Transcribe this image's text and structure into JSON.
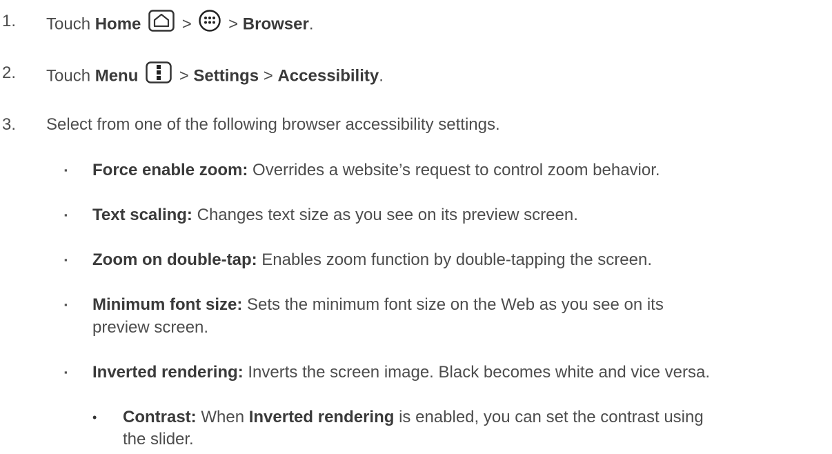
{
  "steps": [
    {
      "number": "1.",
      "prefix": "Touch ",
      "home": "Home",
      "sep1": " > ",
      "sep2": " > ",
      "browser": "Browser",
      "end": ".",
      "icons": [
        "home-icon",
        "apps-icon"
      ]
    },
    {
      "number": "2.",
      "prefix": "Touch ",
      "menu": "Menu",
      "sep1": " > ",
      "settings": "Settings",
      "sep2": " > ",
      "accessibility": "Accessibility",
      "end": ".",
      "icons": [
        "menu-icon"
      ]
    },
    {
      "number": "3.",
      "text": "Select from one of the following browser accessibility settings."
    }
  ],
  "options": [
    {
      "bullet": "▪",
      "term": "Force enable zoom:",
      "desc": " Overrides a website’s request to control zoom behavior."
    },
    {
      "bullet": "▪",
      "term": "Text scaling:",
      "desc": " Changes text size as you see on its preview screen."
    },
    {
      "bullet": "▪",
      "term": "Zoom on double-tap:",
      "desc": " Enables zoom function by double-tapping the screen."
    },
    {
      "bullet": "▪",
      "term": "Minimum font size:",
      "desc": " Sets the minimum font size on the Web as you see on its",
      "desc2": "preview screen."
    },
    {
      "bullet": "▪",
      "term": "Inverted rendering:",
      "desc": " Inverts the screen image. Black becomes white and vice versa."
    }
  ],
  "sub_option": {
    "bullet": "•",
    "term": "Contrast:",
    "desc_a": " When ",
    "term2": "Inverted rendering",
    "desc_b": " is enabled, you can set the contrast using",
    "desc2": "the slider."
  }
}
